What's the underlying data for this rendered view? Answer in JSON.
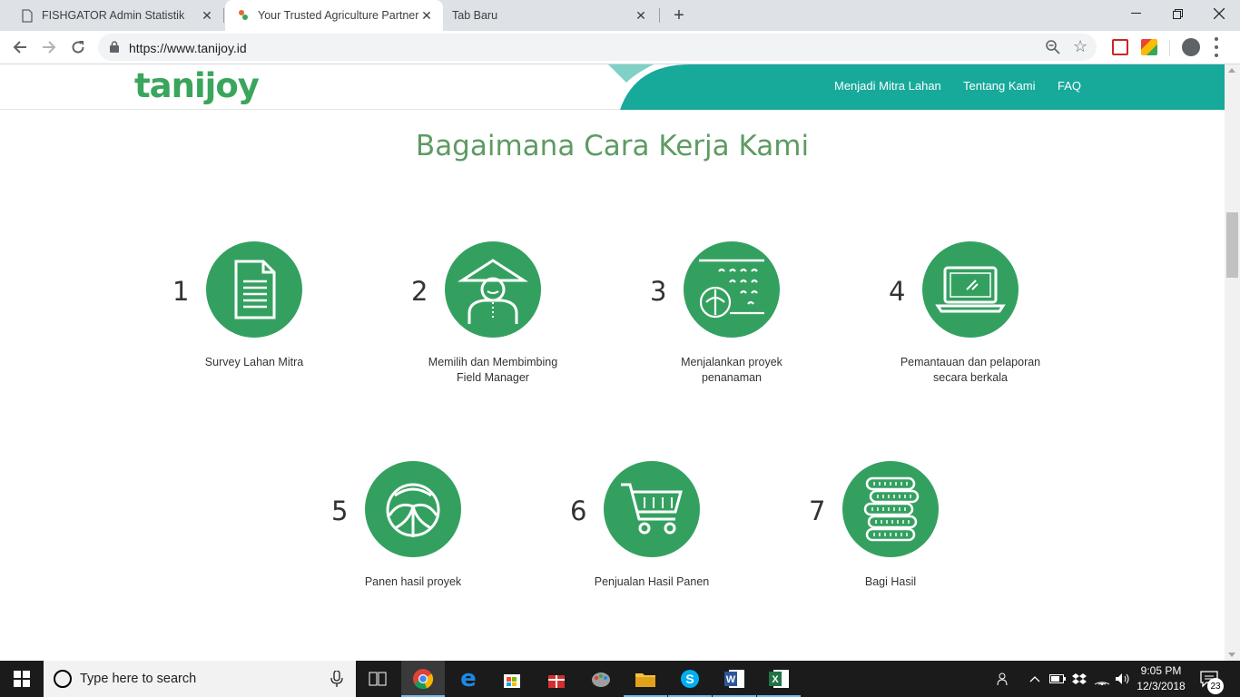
{
  "browser": {
    "tabs": [
      {
        "title": "FISHGATOR Admin Statistik",
        "favicon": "document-icon",
        "active": false
      },
      {
        "title": "Your Trusted Agriculture Partner | T",
        "favicon": "tanijoy-favicon",
        "active": true
      },
      {
        "title": "Tab Baru",
        "favicon": "none",
        "active": false
      }
    ],
    "url": "https://www.tanijoy.id",
    "window_controls": [
      "minimize",
      "restore",
      "close"
    ]
  },
  "site": {
    "logo": "tanijoy",
    "nav": [
      "Menjadi Mitra Lahan",
      "Tentang Kami",
      "FAQ"
    ],
    "section_title": "Bagaimana Cara Kerja Kami",
    "steps": [
      {
        "number": "1",
        "label_line1": "Survey Lahan Mitra",
        "label_line2": "",
        "icon": "document-icon"
      },
      {
        "number": "2",
        "label_line1": "Memilih dan Membimbing",
        "label_line2": "Field Manager",
        "icon": "farmer-icon"
      },
      {
        "number": "3",
        "label_line1": "Menjalankan proyek",
        "label_line2": "penanaman",
        "icon": "planting-field-icon"
      },
      {
        "number": "4",
        "label_line1": "Pemantauan dan pelaporan",
        "label_line2": "secara berkala",
        "icon": "laptop-icon"
      },
      {
        "number": "5",
        "label_line1": "Panen hasil proyek",
        "label_line2": "",
        "icon": "cabbage-icon"
      },
      {
        "number": "6",
        "label_line1": "Penjualan Hasil Panen",
        "label_line2": "",
        "icon": "shopping-cart-icon"
      },
      {
        "number": "7",
        "label_line1": "Bagi Hasil",
        "label_line2": "",
        "icon": "coin-stack-icon"
      }
    ]
  },
  "taskbar": {
    "search_placeholder": "Type here to search",
    "apps": [
      "task-view-icon",
      "chrome-icon",
      "edge-icon",
      "store-icon",
      "gift-icon",
      "paint-icon",
      "file-explorer-icon",
      "skype-icon",
      "word-icon",
      "excel-icon"
    ],
    "time": "9:05 PM",
    "date": "12/3/2018",
    "notification_count": "23"
  },
  "colors": {
    "brand_green": "#34a060",
    "title_green": "#5e9b63",
    "header_teal": "#17a99a",
    "taskbar": "#1b1b1b"
  }
}
